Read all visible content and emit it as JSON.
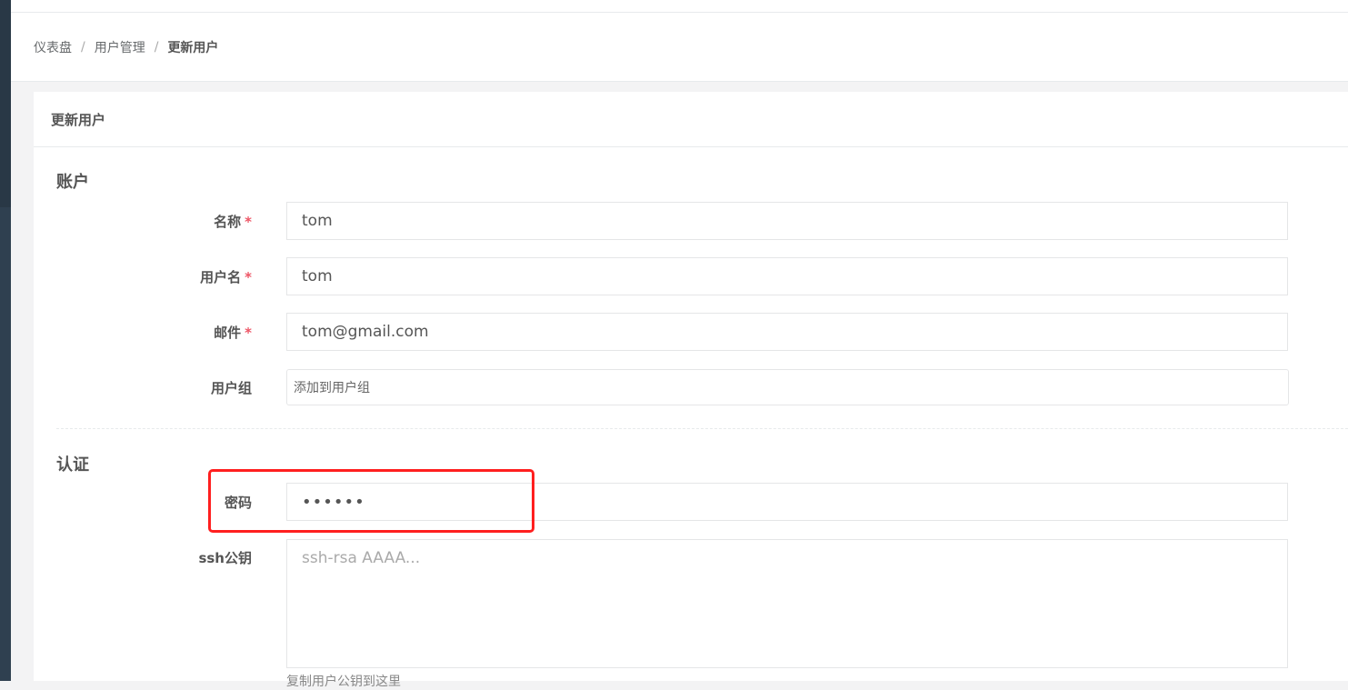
{
  "breadcrumb": {
    "items": [
      "仪表盘",
      "用户管理"
    ],
    "active": "更新用户",
    "separator": "/"
  },
  "panel": {
    "title": "更新用户"
  },
  "account_section": {
    "title": "账户",
    "name_label": "名称",
    "name_value": "tom",
    "username_label": "用户名",
    "username_value": "tom",
    "email_label": "邮件",
    "email_value": "tom@gmail.com",
    "group_label": "用户组",
    "group_placeholder": "添加到用户组",
    "required_mark": "*"
  },
  "auth_section": {
    "title": "认证",
    "password_label": "密码",
    "password_value": "••••••",
    "ssh_label": "ssh公钥",
    "ssh_placeholder": "ssh-rsa AAAA...",
    "ssh_help": "复制用户公钥到这里"
  },
  "colors": {
    "highlight_border": "#ff1f1f",
    "required": "#ed5565",
    "sidebar": "#2f4050"
  }
}
